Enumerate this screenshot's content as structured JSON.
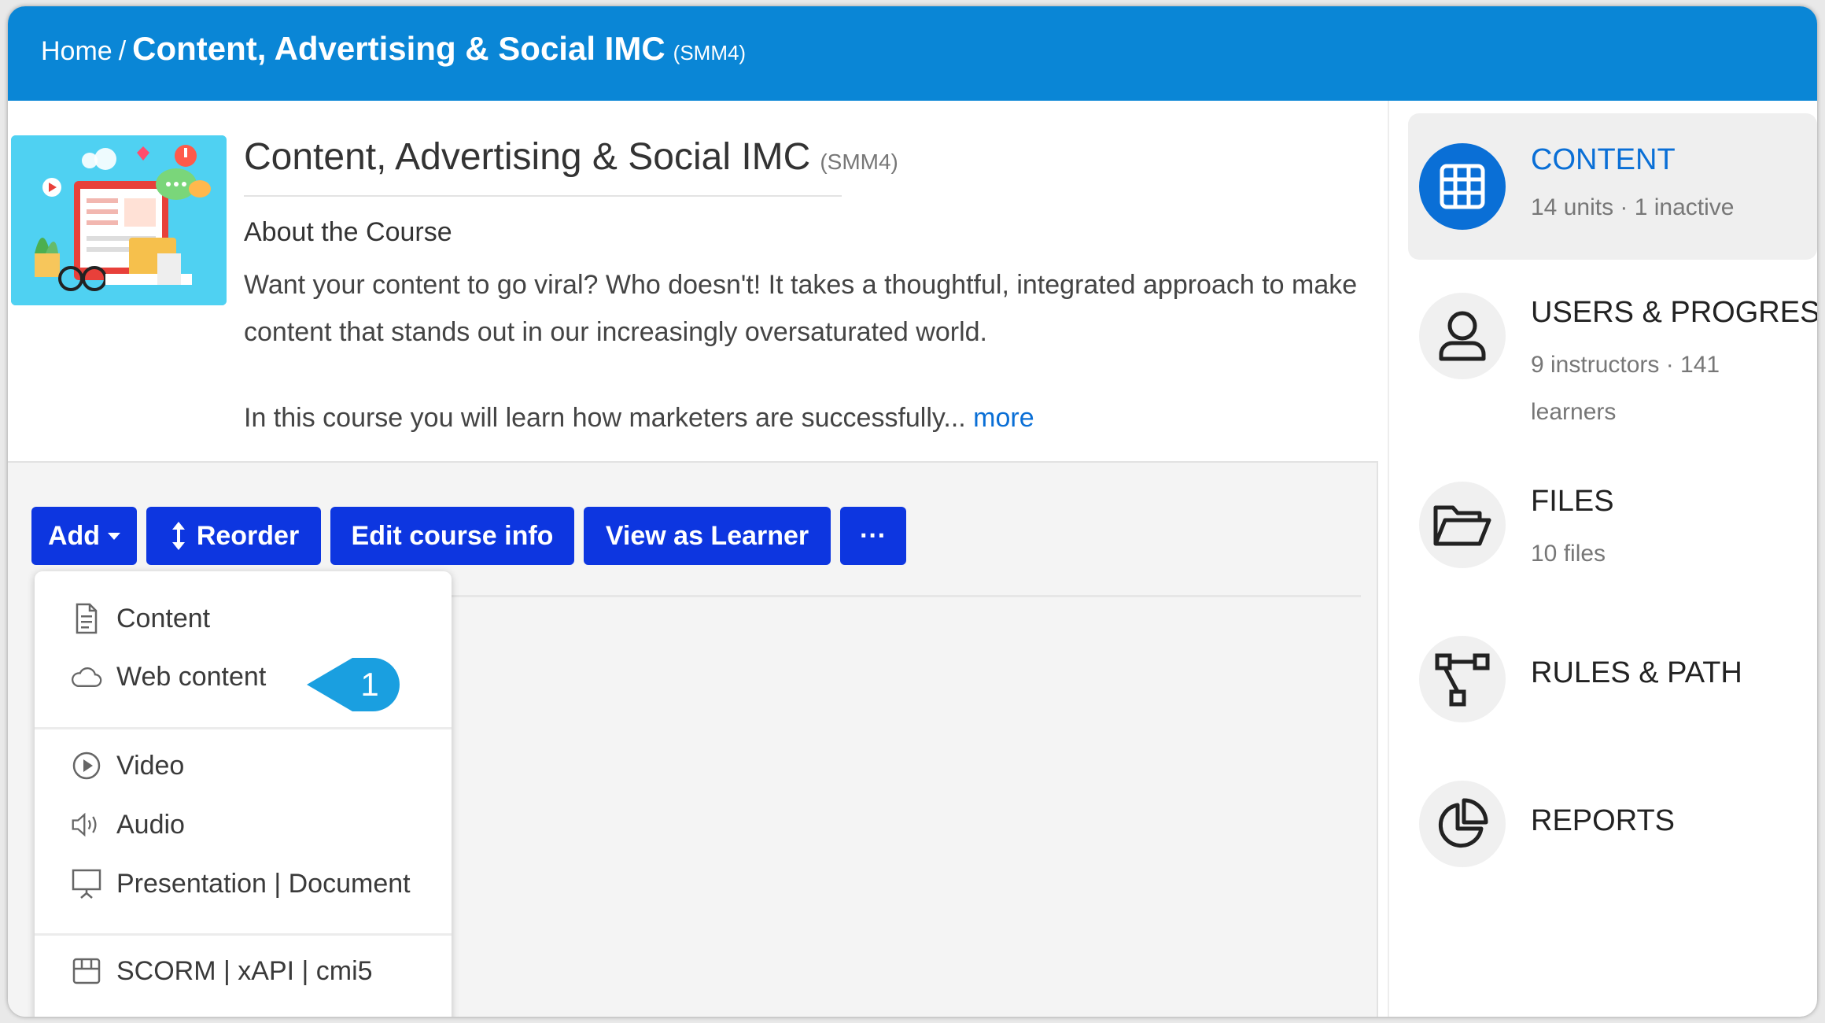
{
  "breadcrumb": {
    "home": "Home",
    "separator": "/",
    "current": "Content, Advertising & Social IMC",
    "code": "(SMM4)"
  },
  "course": {
    "title": "Content, Advertising & Social IMC",
    "code": "(SMM4)",
    "about_heading": "About the Course",
    "about_text": "Want your content to go viral? Who doesn't! It takes a thoughtful, integrated approach to make content that stands out in our increasingly oversaturated world.",
    "about_text_2": "In this course you will learn how marketers are successfully...",
    "more_link": "more"
  },
  "toolbar": {
    "add_label": "Add",
    "reorder_label": "Reorder",
    "edit_label": "Edit course info",
    "view_label": "View as Learner",
    "more_label": "···"
  },
  "add_menu": {
    "items": [
      {
        "label": "Content",
        "icon": "document-icon"
      },
      {
        "label": "Web content",
        "icon": "cloud-icon"
      },
      {
        "label": "Video",
        "icon": "play-circle-icon"
      },
      {
        "label": "Audio",
        "icon": "speaker-icon"
      },
      {
        "label": "Presentation | Document",
        "icon": "presentation-icon"
      },
      {
        "label": "SCORM | xAPI | cmi5",
        "icon": "package-icon"
      }
    ]
  },
  "callout": {
    "number": "1",
    "color": "#1a9fe0"
  },
  "sidebar": {
    "items": [
      {
        "title": "CONTENT",
        "sub": "14 units · 1 inactive",
        "icon": "grid-icon",
        "active": true
      },
      {
        "title": "USERS & PROGRESS",
        "sub": "9 instructors · 141 learners",
        "icon": "user-icon"
      },
      {
        "title": "FILES",
        "sub": "10 files",
        "icon": "folder-open-icon"
      },
      {
        "title": "RULES & PATH",
        "sub": "",
        "icon": "path-icon"
      },
      {
        "title": "REPORTS",
        "sub": "",
        "icon": "pie-chart-icon"
      }
    ]
  },
  "colors": {
    "header": "#0a86d6",
    "button": "#0d36e0",
    "accent": "#0a6fd6"
  }
}
